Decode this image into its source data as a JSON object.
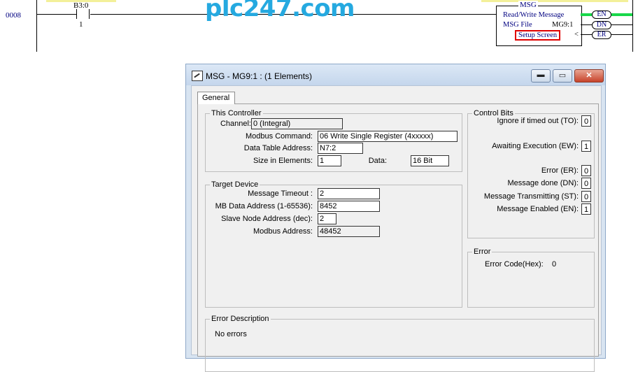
{
  "ladder": {
    "rung_number": "0008",
    "contact_address": "B3:0",
    "contact_bit": "1",
    "watermark": "plc247.com",
    "msg": {
      "title": "MSG",
      "line1": "Read/Write Message",
      "line2": "MSG File",
      "file_value": "MG9:1",
      "setup_button": "Setup Screen",
      "lt_symbol": "<",
      "coils": [
        "EN",
        "DN",
        "ER"
      ]
    }
  },
  "dialog": {
    "title": "MSG - MG9:1 : (1 Elements)",
    "buttons": {
      "minimize": "▬",
      "maximize": "▭",
      "close": "✕"
    },
    "tab_general": "General",
    "this_controller": {
      "legend": "This Controller",
      "channel_label": "Channel:",
      "channel_value": "0 (Integral)",
      "modbus_command_label": "Modbus Command:",
      "modbus_command_value": "06 Write Single Register (4xxxxx)",
      "data_table_label": "Data Table Address:",
      "data_table_value": "N7:2",
      "size_label": "Size in Elements:",
      "size_value": "1",
      "data_label": "Data:",
      "data_value": "16 Bit"
    },
    "target_device": {
      "legend": "Target Device",
      "timeout_label": "Message Timeout :",
      "timeout_value": "2",
      "mb_data_label": "MB Data Address (1-65536):",
      "mb_data_value": "8452",
      "slave_label": "Slave Node Address (dec):",
      "slave_value": "2",
      "modbus_addr_label": "Modbus Address:",
      "modbus_addr_value": "48452"
    },
    "control_bits": {
      "legend": "Control Bits",
      "items": [
        {
          "label": "Ignore if timed out (TO):",
          "value": "0"
        },
        {
          "label": "Awaiting Execution (EW):",
          "value": "1"
        },
        {
          "label": "Error (ER):",
          "value": "0"
        },
        {
          "label": "Message done (DN):",
          "value": "0"
        },
        {
          "label": "Message Transmitting (ST):",
          "value": "0"
        },
        {
          "label": "Message Enabled (EN):",
          "value": "1"
        }
      ]
    },
    "error": {
      "legend": "Error",
      "code_label": "Error Code(Hex):",
      "code_value": "0"
    },
    "error_description": {
      "legend": "Error Description",
      "text": "No errors"
    }
  }
}
